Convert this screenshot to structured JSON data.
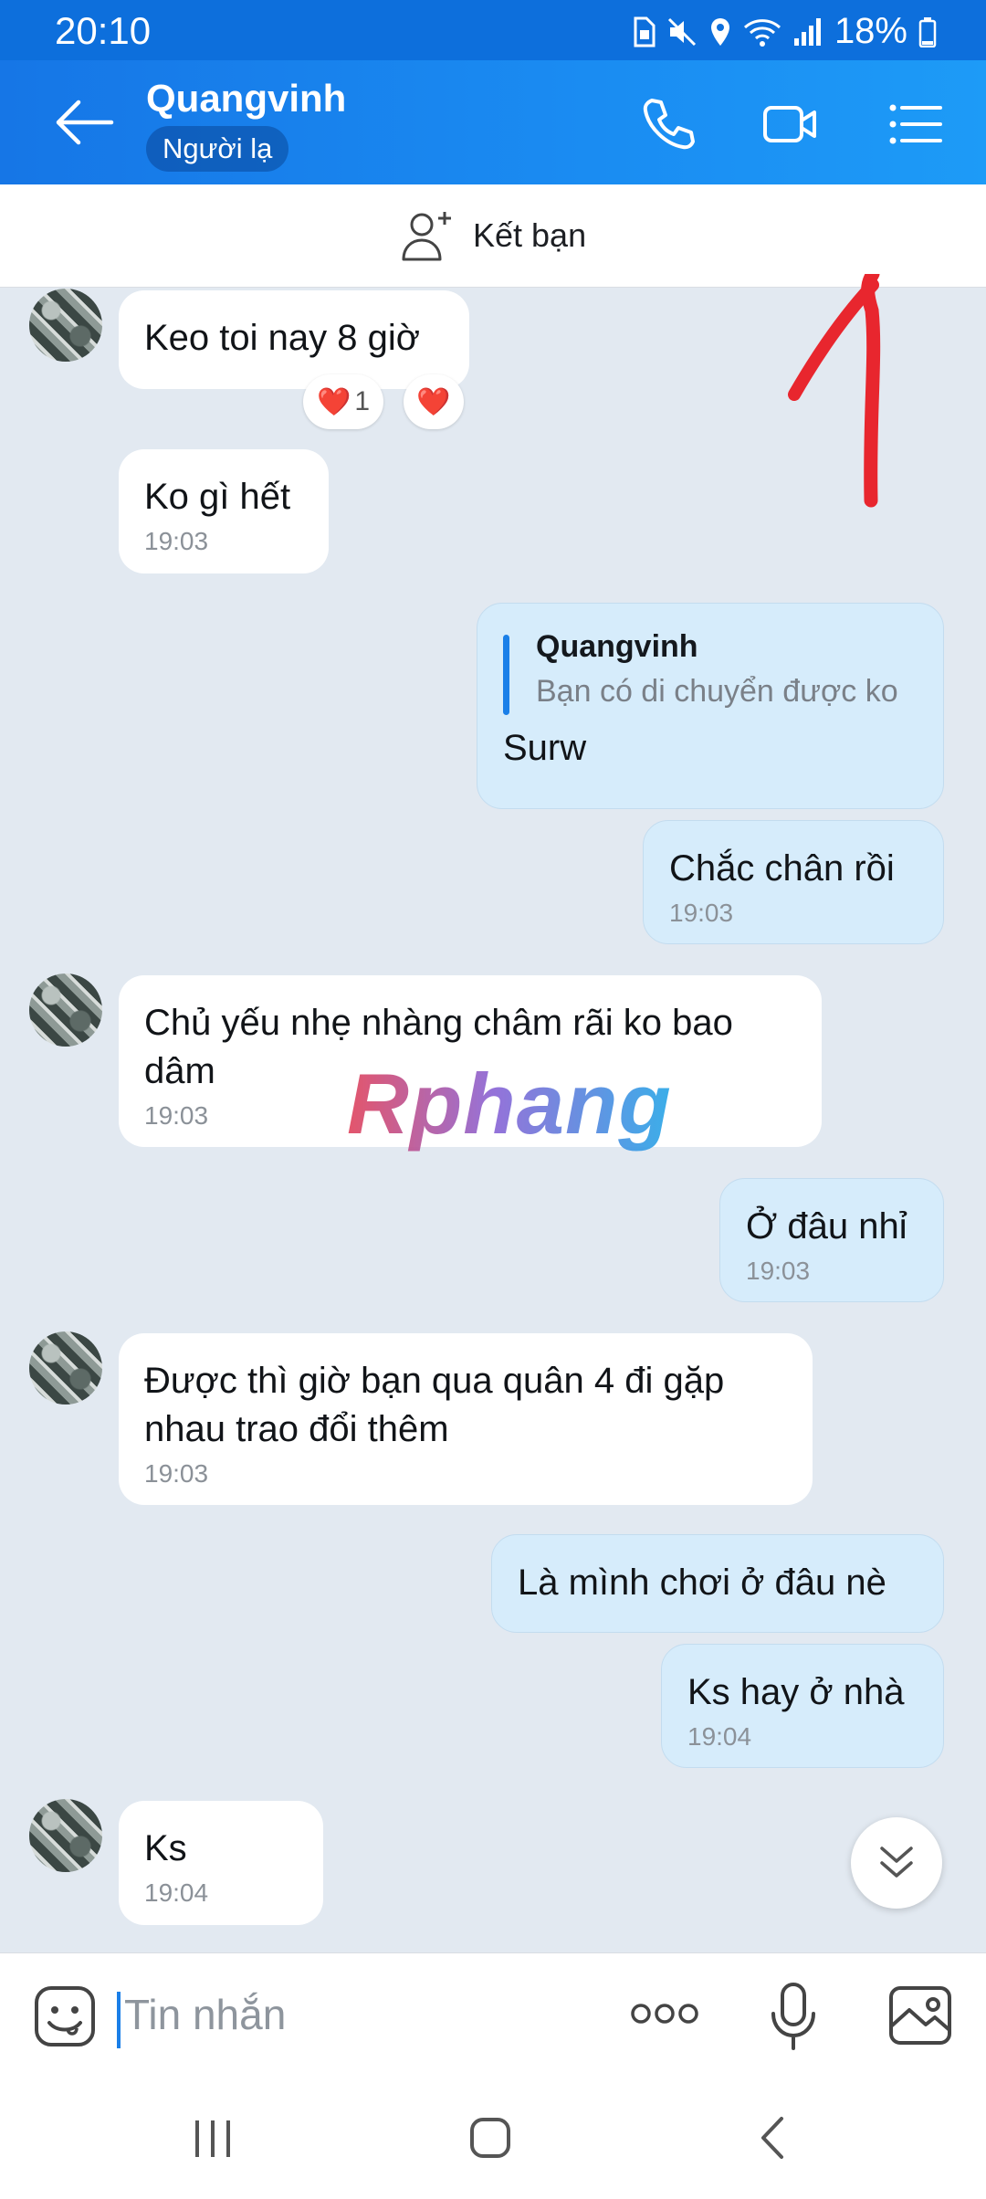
{
  "status_bar": {
    "time": "20:10",
    "battery": "18%"
  },
  "header": {
    "title": "Quangvinh",
    "badge": "Người lạ"
  },
  "add_friend": {
    "label": "Kết bạn"
  },
  "messages": [
    {
      "text": "Keo toi nay 8 giờ",
      "reaction_count": "1"
    },
    {
      "text": "Ko gì hết",
      "time": "19:03"
    },
    {
      "quote_name": "Quangvinh",
      "quote_text": "Bạn có di chuyển được ko",
      "text": "Surw"
    },
    {
      "text": "Chắc chân rồi",
      "time": "19:03"
    },
    {
      "text": "Chủ yếu nhẹ nhàng châm rãi ko bao dâm",
      "time": "19:03"
    },
    {
      "text": "Ở đâu nhỉ",
      "time": "19:03"
    },
    {
      "text": "Được thì giờ bạn qua quân 4 đi gặp nhau trao đổi thêm",
      "time": "19:03"
    },
    {
      "text": "Là mình chơi ở đâu nè"
    },
    {
      "text": "Ks hay ở nhà",
      "time": "19:04"
    },
    {
      "text": "Ks",
      "time": "19:04"
    }
  ],
  "watermark": "Rphang",
  "composer": {
    "placeholder": "Tin nhắn"
  },
  "colors": {
    "header": "#1a8cf2",
    "outgoing_bubble": "#d6ecfb",
    "chat_bg": "#e2e9f1",
    "annotation": "#e8262e"
  }
}
